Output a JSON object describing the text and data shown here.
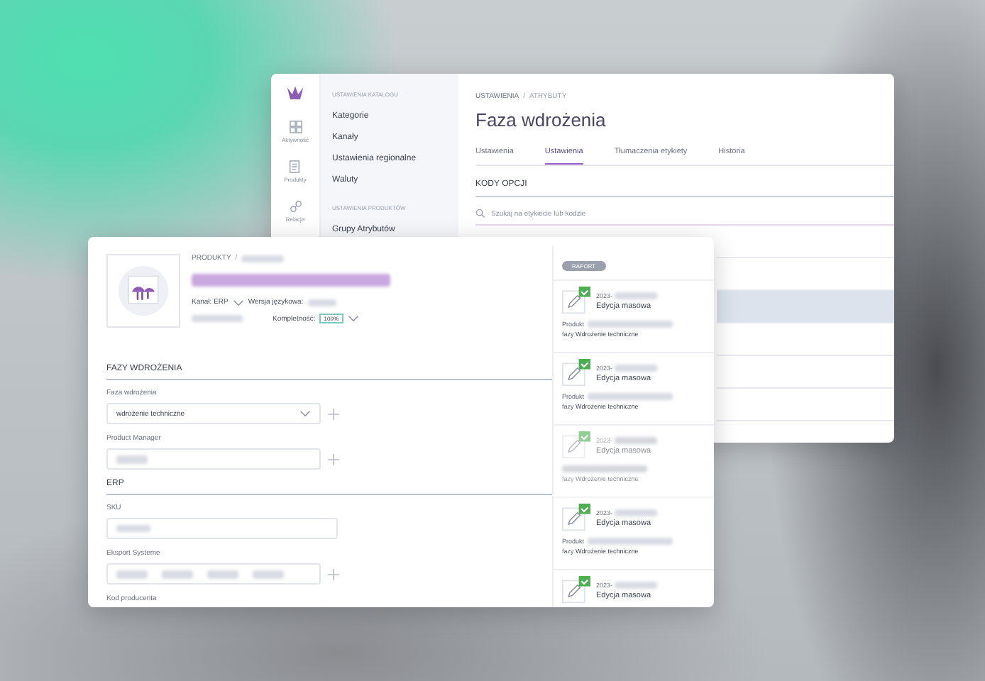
{
  "back_window": {
    "rail": [
      {
        "label": "Aktywność",
        "kind": "grid"
      },
      {
        "label": "Produkty",
        "kind": "doc"
      },
      {
        "label": "Relacje",
        "kind": "link"
      }
    ],
    "nav_sections": [
      {
        "heading": "USTAWIENIA KATALOGU",
        "items": [
          "Kategorie",
          "Kanały",
          "Ustawienia regionalne",
          "Waluty"
        ]
      },
      {
        "heading": "USTAWIENIA PRODUKTÓW",
        "items": [
          "Grupy Atrybutów"
        ]
      }
    ],
    "breadcrumb": [
      "USTAWIENIA",
      "/",
      "ATRYBUTY"
    ],
    "title": "Faza wdrożenia",
    "tabs": [
      {
        "label": "Ustawienia",
        "selected": false
      },
      {
        "label": "Ustawienia",
        "selected": true
      },
      {
        "label": "Tłumaczenia etykiety",
        "selected": false
      },
      {
        "label": "Historia",
        "selected": false
      }
    ],
    "section": "KODY OPCJI",
    "search": {
      "placeholder": "Szukaj na etykiecie lub kodzie"
    },
    "option_rows": [
      {
        "selected": false
      },
      {
        "selected": false
      },
      {
        "selected": true
      },
      {
        "selected": false
      },
      {
        "selected": false
      },
      {
        "selected": false
      }
    ]
  },
  "front_window": {
    "breadcrumb": [
      "PRODUKTY",
      "/"
    ],
    "channel_label": "Kanał: ERP",
    "language_label": "Wersja językowa:",
    "completeness_label": "Kompletność:",
    "completeness_value": "100%",
    "sections": [
      {
        "heading": "FAZY WDROŻENIA",
        "fields": [
          {
            "label": "Faza wdrożenia",
            "kind": "select",
            "value": "wdrożenie techniczne",
            "addable": true
          },
          {
            "label": "Product Manager",
            "kind": "person",
            "addable": true
          }
        ]
      },
      {
        "heading": "ERP",
        "fields": [
          {
            "label": "SKU",
            "kind": "text",
            "addable": false
          },
          {
            "label": "Eksport Systeme",
            "kind": "tags",
            "addable": true
          },
          {
            "label": "Kod producenta",
            "kind": "cut"
          }
        ]
      }
    ],
    "history": {
      "report_button": "RAPORT",
      "entries": [
        {
          "date": "2023-",
          "title": "Edycja masowa",
          "product_label": "Produkt",
          "phase": "fazy **Wdrożenie techniczne**",
          "faded": false
        },
        {
          "date": "2023-",
          "title": "Edycja masowa",
          "product_label": "Produkt",
          "phase": "fazy **Wdrożenie techniczne**",
          "faded": false
        },
        {
          "date": "2023-",
          "title": "Edycja masowa",
          "phase": "fazy **Wdrożenie techniczne**",
          "faded": true
        },
        {
          "date": "2023-",
          "title": "Edycja masowa",
          "product_label": "Produkt",
          "phase": "fazy **Wdrożenie techniczne**",
          "faded": false
        },
        {
          "date": "2023-",
          "title": "Edycja masowa",
          "faded": false
        }
      ]
    }
  }
}
